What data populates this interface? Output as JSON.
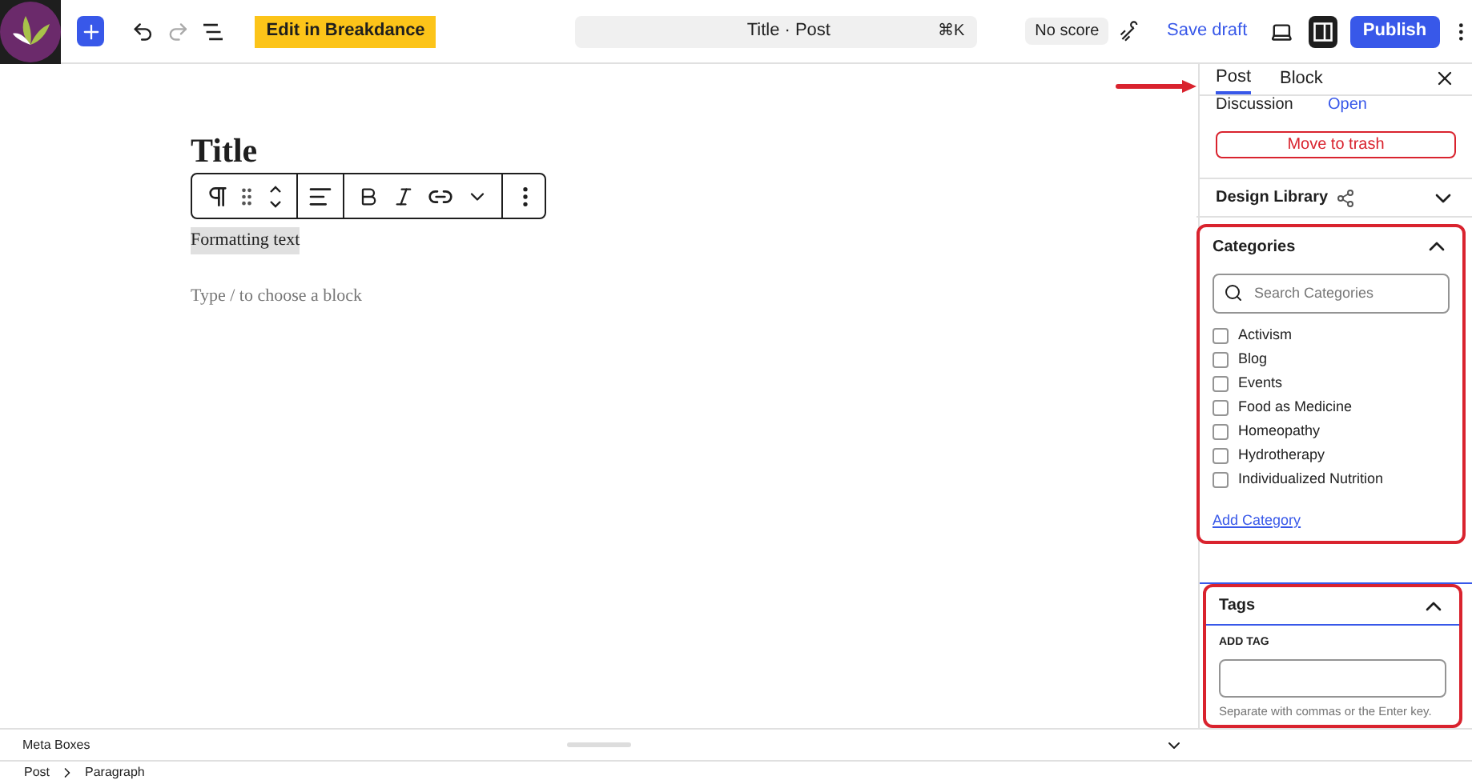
{
  "toolbar": {
    "edit_button": "Edit in Breakdance",
    "command": {
      "title": "Title · Post",
      "shortcut": "⌘K"
    },
    "score": "No score",
    "save_draft": "Save draft",
    "publish": "Publish",
    "sidebar_toggle": {
      "selected": true
    }
  },
  "editor": {
    "title": "Title",
    "paragraph": "Formatting text",
    "placeholder": "Type / to choose a block"
  },
  "sidebar": {
    "tabs": [
      {
        "label": "Post",
        "selected": true
      },
      {
        "label": "Block",
        "selected": false
      }
    ],
    "discussion": {
      "label": "Discussion",
      "value": "Open"
    },
    "trash": "Move to trash",
    "design_library": {
      "label": "Design Library",
      "expanded": false
    },
    "categories": {
      "label": "Categories",
      "expanded": true,
      "search_placeholder": "Search Categories",
      "items": [
        {
          "label": "Activism",
          "checked": false
        },
        {
          "label": "Blog",
          "checked": false
        },
        {
          "label": "Events",
          "checked": false
        },
        {
          "label": "Food as Medicine",
          "checked": false
        },
        {
          "label": "Homeopathy",
          "checked": false
        },
        {
          "label": "Hydrotherapy",
          "checked": false
        },
        {
          "label": "Individualized Nutrition",
          "checked": false
        }
      ],
      "add": "Add Category"
    },
    "tags": {
      "label": "Tags",
      "expanded": true,
      "field_label": "ADD TAG",
      "help": "Separate with commas or the Enter key."
    }
  },
  "meta_boxes": "Meta Boxes",
  "breadcrumb": [
    "Post",
    "Paragraph"
  ]
}
